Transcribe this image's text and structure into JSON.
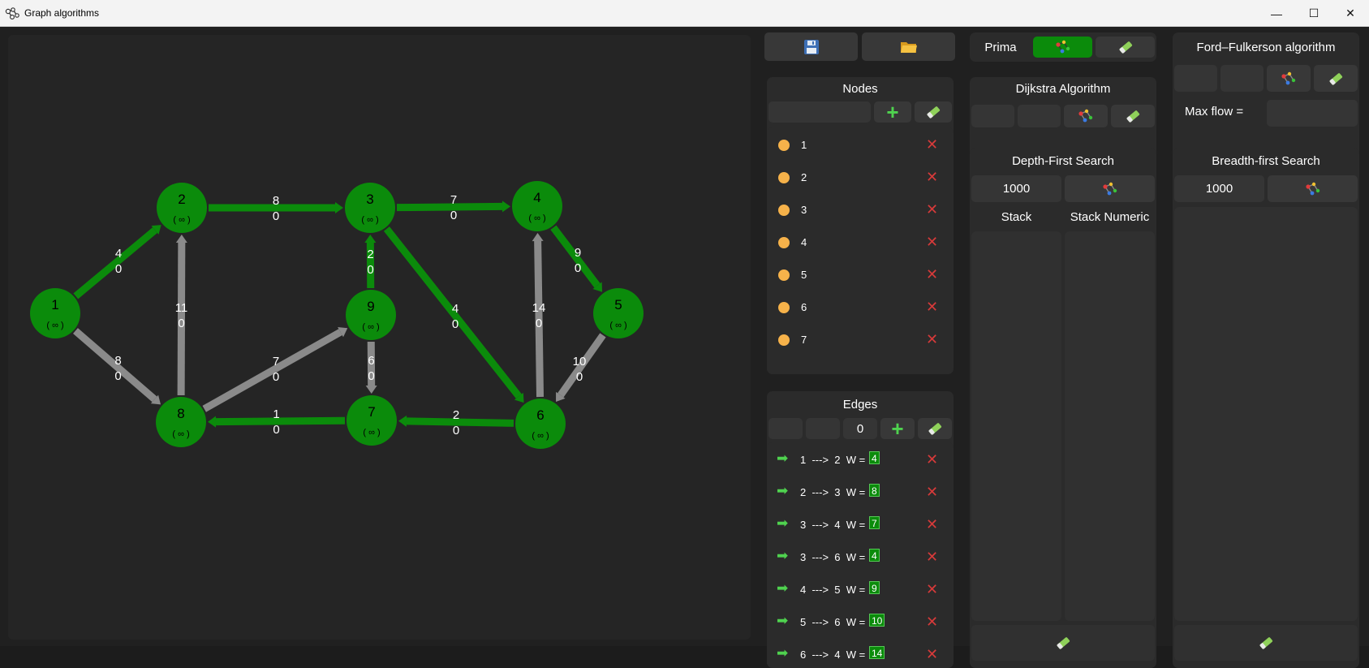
{
  "window": {
    "title": "Graph algorithms",
    "min": "—",
    "max": "☐",
    "close": "✕"
  },
  "icons": {
    "save": "floppy-disk-icon",
    "open": "folder-icon",
    "eraser": "eraser-icon",
    "graph": "graph-nodes-icon",
    "add": "plus-icon",
    "delete": "close-x-icon",
    "edge": "right-arrow-icon"
  },
  "colors": {
    "node": "#0b8b0b",
    "edge_active": "#0b8b0b",
    "edge_inactive": "#8a8a8a",
    "node_dot": "#f6b24a",
    "delete": "#d73a3a"
  },
  "graph": {
    "nodes": [
      {
        "id": "1",
        "dist": "( ∞ )"
      },
      {
        "id": "2",
        "dist": "( ∞ )"
      },
      {
        "id": "3",
        "dist": "( ∞ )"
      },
      {
        "id": "4",
        "dist": "( ∞ )"
      },
      {
        "id": "5",
        "dist": "( ∞ )"
      },
      {
        "id": "6",
        "dist": "( ∞ )"
      },
      {
        "id": "7",
        "dist": "( ∞ )"
      },
      {
        "id": "8",
        "dist": "( ∞ )"
      },
      {
        "id": "9",
        "dist": "( ∞ )"
      }
    ],
    "edges": [
      {
        "from": "1",
        "to": "2",
        "w": "4",
        "flow": "0",
        "active": true
      },
      {
        "from": "2",
        "to": "3",
        "w": "8",
        "flow": "0",
        "active": true
      },
      {
        "from": "3",
        "to": "4",
        "w": "7",
        "flow": "0",
        "active": true
      },
      {
        "from": "9",
        "to": "3",
        "w": "2",
        "flow": "0",
        "active": true
      },
      {
        "from": "3",
        "to": "6",
        "w": "4",
        "flow": "0",
        "active": true
      },
      {
        "from": "4",
        "to": "5",
        "w": "9",
        "flow": "0",
        "active": true
      },
      {
        "from": "6",
        "to": "4",
        "w": "14",
        "flow": "0",
        "active": false
      },
      {
        "from": "5",
        "to": "6",
        "w": "10",
        "flow": "0",
        "active": false
      },
      {
        "from": "8",
        "to": "2",
        "w": "11",
        "flow": "0",
        "active": false
      },
      {
        "from": "1",
        "to": "8",
        "w": "8",
        "flow": "0",
        "active": false
      },
      {
        "from": "8",
        "to": "9",
        "w": "7",
        "flow": "0",
        "active": false
      },
      {
        "from": "9",
        "to": "7",
        "w": "6",
        "flow": "0",
        "active": false
      },
      {
        "from": "7",
        "to": "8",
        "w": "1",
        "flow": "0",
        "active": true
      },
      {
        "from": "6",
        "to": "7",
        "w": "2",
        "flow": "0",
        "active": true
      }
    ]
  },
  "nodes_panel": {
    "title": "Nodes",
    "input_value": "",
    "items": [
      "1",
      "2",
      "3",
      "4",
      "5",
      "6",
      "7"
    ]
  },
  "edges_panel": {
    "title": "Edges",
    "from_value": "",
    "to_value": "",
    "weight_value": "0",
    "items": [
      {
        "from": "1",
        "to": "2",
        "arrow": "--->",
        "w_label": "W =",
        "w": "4"
      },
      {
        "from": "2",
        "to": "3",
        "arrow": "--->",
        "w_label": "W =",
        "w": "8"
      },
      {
        "from": "3",
        "to": "4",
        "arrow": "--->",
        "w_label": "W =",
        "w": "7"
      },
      {
        "from": "3",
        "to": "6",
        "arrow": "--->",
        "w_label": "W =",
        "w": "4"
      },
      {
        "from": "4",
        "to": "5",
        "arrow": "--->",
        "w_label": "W =",
        "w": "9"
      },
      {
        "from": "5",
        "to": "6",
        "arrow": "--->",
        "w_label": "W =",
        "w": "10"
      },
      {
        "from": "6",
        "to": "4",
        "arrow": "--->",
        "w_label": "W =",
        "w": "14"
      }
    ]
  },
  "prima": {
    "label": "Prima"
  },
  "dijkstra": {
    "title": "Dijkstra Algorithm",
    "from_value": "",
    "to_value": ""
  },
  "dfs": {
    "title": "Depth-First Search",
    "delay": "1000",
    "col1": "Stack",
    "col2": "Stack Numeric"
  },
  "ford": {
    "title": "Ford–Fulkerson algorithm",
    "maxflow_label": "Max flow =",
    "maxflow_value": ""
  },
  "bfs": {
    "title": "Breadth-first Search",
    "delay": "1000"
  }
}
